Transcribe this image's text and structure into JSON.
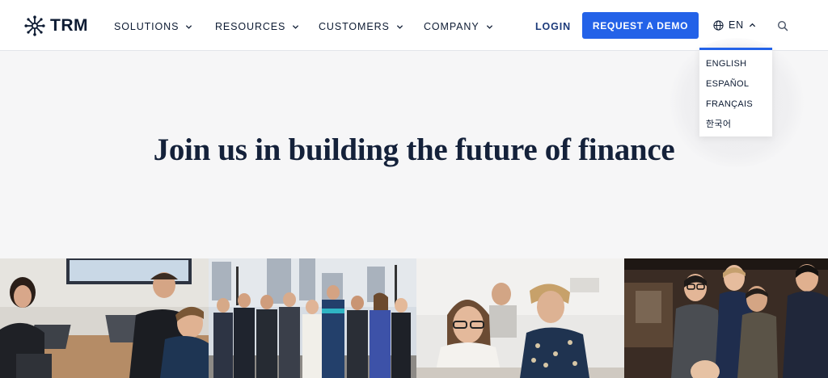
{
  "brand": {
    "name": "TRM"
  },
  "nav": {
    "items": [
      {
        "label": "SOLUTIONS"
      },
      {
        "label": "RESOURCES"
      },
      {
        "label": "CUSTOMERS"
      },
      {
        "label": "COMPANY"
      }
    ],
    "login_label": "LOGIN",
    "demo_label": "REQUEST A DEMO",
    "language_label": "EN"
  },
  "language_menu": {
    "options": [
      "ENGLISH",
      "ESPAÑOL",
      "FRANÇAIS",
      "한국어"
    ]
  },
  "hero": {
    "title": "Join us in building the future of finance"
  },
  "photos": [
    {
      "name": "office-meeting-photo"
    },
    {
      "name": "team-waterfront-photo"
    },
    {
      "name": "coworkers-desk-photo"
    },
    {
      "name": "team-event-photo"
    }
  ],
  "colors": {
    "accent": "#2362e8",
    "text": "#0d1b33",
    "background": "#f6f6f7"
  }
}
